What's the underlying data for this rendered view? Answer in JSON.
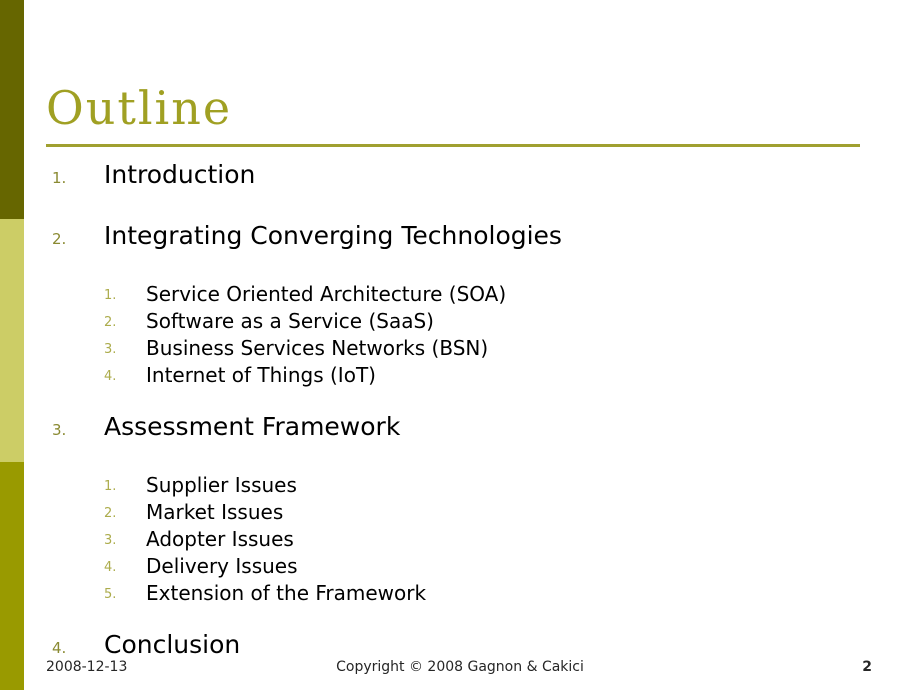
{
  "slide": {
    "title": "Outline",
    "page_number": "2",
    "theme": {
      "sidebar_top_color": "#666600",
      "sidebar_middle_color": "#cccd66",
      "sidebar_bottom_color": "#999a00",
      "title_color": "#a0a023",
      "rule_color": "#a0a030",
      "level1_number_color": "#8a8a32",
      "level2_number_color": "#acac4c",
      "body_text_color": "#000000",
      "background_color": "#ffffff"
    }
  },
  "outline": [
    {
      "number": "1.",
      "label": "Introduction",
      "children": []
    },
    {
      "number": "2.",
      "label": "Integrating Converging Technologies",
      "children": [
        {
          "number": "1.",
          "label": "Service Oriented Architecture (SOA)"
        },
        {
          "number": "2.",
          "label": "Software as a Service (SaaS)"
        },
        {
          "number": "3.",
          "label": "Business Services Networks (BSN)"
        },
        {
          "number": "4.",
          "label": "Internet of Things (IoT)"
        }
      ]
    },
    {
      "number": "3.",
      "label": "Assessment Framework",
      "children": [
        {
          "number": "1.",
          "label": "Supplier Issues"
        },
        {
          "number": "2.",
          "label": "Market Issues"
        },
        {
          "number": "3.",
          "label": "Adopter Issues"
        },
        {
          "number": "4.",
          "label": "Delivery Issues"
        },
        {
          "number": "5.",
          "label": "Extension of the Framework"
        }
      ]
    },
    {
      "number": "4.",
      "label": "Conclusion",
      "children": []
    }
  ],
  "footer": {
    "date": "2008-12-13",
    "copyright": "Copyright © 2008 Gagnon & Cakici",
    "page_number": "2"
  }
}
